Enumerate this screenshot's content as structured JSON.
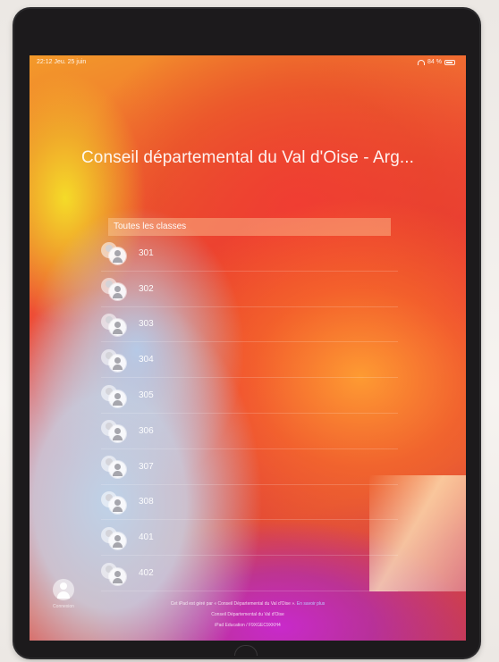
{
  "status_bar": {
    "time": "22:12",
    "date": "Jeu. 25 juin",
    "battery": "84 %",
    "battery_level": 0.84
  },
  "org_title": "Conseil départemental du Val d'Oise - Arg...",
  "group_header": "Toutes les classes",
  "classes": [
    "301",
    "302",
    "303",
    "304",
    "305",
    "306",
    "307",
    "308",
    "401",
    "402"
  ],
  "profile": {
    "label": "Connexion"
  },
  "footer": {
    "line1": "Cet iPad est géré par « Conseil Départemental du Val d'Oise ».",
    "more_link": "En savoir plus",
    "line2": "Conseil Départemental du Val d'Oise",
    "line3": "iPad Education / F9XGEC9XKH4"
  },
  "colors": {
    "title_text": "#ffffff",
    "header_band": "#ffd2a0",
    "wallpaper_orange": "#ee4d35",
    "wallpaper_magenta": "#c828d2",
    "wallpaper_yellow": "#f5e128",
    "wallpaper_blue_gray": "#bed2e8"
  }
}
